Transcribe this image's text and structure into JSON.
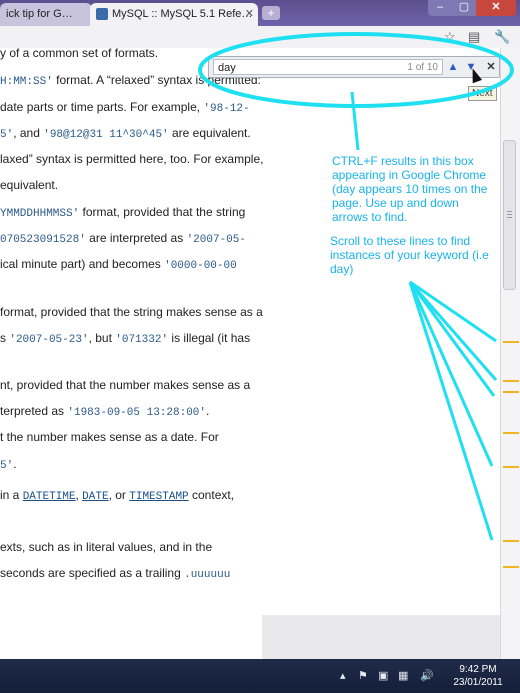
{
  "tabs": [
    {
      "label": "ick tip for G…",
      "active": false
    },
    {
      "label": "MySQL :: MySQL 5.1 Refe…",
      "active": true
    }
  ],
  "window_buttons": {
    "minimize": "–",
    "maximize": "▢",
    "close": "✕"
  },
  "toolbar_icons": [
    "star-icon",
    "page-icon",
    "wrench-icon"
  ],
  "find_bar": {
    "query": "day",
    "count": "1 of 10",
    "prev": "▲",
    "next": "▼",
    "close": "✕",
    "tooltip": "Next"
  },
  "content_lines": [
    {
      "t": [
        {
          "s": "y of a common set of formats."
        }
      ]
    },
    {
      "t": [
        {
          "s": "H:MM:SS'",
          "c": 1
        },
        {
          "s": " format. A “relaxed” syntax is permitted:"
        }
      ]
    },
    {
      "t": [
        {
          "s": " date parts or time parts. For example, "
        },
        {
          "s": "'98-12-",
          "c": 1
        }
      ]
    },
    {
      "t": [
        {
          "s": "5'",
          "c": 1
        },
        {
          "s": ", and "
        },
        {
          "s": "'98@12@31 11^30^45'",
          "c": 1
        },
        {
          "s": " are equivalent."
        }
      ]
    },
    {
      "t": [
        {
          "s": "laxed” syntax is permitted here, too. For example,"
        }
      ]
    },
    {
      "t": [
        {
          "s": "equivalent."
        }
      ]
    },
    {
      "t": [
        {
          "s": "YMMDDHHMMSS'",
          "c": 1
        },
        {
          "s": " format, provided that the string"
        }
      ]
    },
    {
      "t": [
        {
          "s": "070523091528'",
          "c": 1
        },
        {
          "s": " are interpreted as "
        },
        {
          "s": "'2007-05-",
          "c": 1
        }
      ]
    },
    {
      "t": [
        {
          "s": "ical minute part) and becomes "
        },
        {
          "s": "'0000-00-00",
          "c": 1
        }
      ]
    },
    {
      "t": [
        {
          "s": " format, provided that the string makes sense as a"
        }
      ]
    },
    {
      "t": [
        {
          "s": "s "
        },
        {
          "s": "'2007-05-23'",
          "c": 1
        },
        {
          "s": ", but "
        },
        {
          "s": "'071332'",
          "c": 1
        },
        {
          "s": " is illegal (it has"
        }
      ]
    },
    {
      "t": [
        {
          "s": "nt, provided that the number makes sense as a"
        }
      ]
    },
    {
      "t": [
        {
          "s": "terpreted as "
        },
        {
          "s": "'1983-09-05 13:28:00'",
          "c": 1
        },
        {
          "s": "."
        }
      ]
    },
    {
      "t": [
        {
          "s": "t the number makes sense as a date. For"
        }
      ]
    },
    {
      "t": [
        {
          "s": "5'",
          "c": 1
        },
        {
          "s": "."
        }
      ]
    },
    {
      "t": [
        {
          "s": " in a "
        },
        {
          "s": "DATETIME",
          "c": 2
        },
        {
          "s": ", "
        },
        {
          "s": "DATE",
          "c": 2
        },
        {
          "s": ", or "
        },
        {
          "s": "TIMESTAMP",
          "c": 2
        },
        {
          "s": " context,"
        }
      ]
    },
    {
      "t": [
        {
          "s": "exts, such as in literal values, and in the"
        }
      ]
    },
    {
      "t": [
        {
          "s": "seconds are specified as a trailing "
        },
        {
          "s": ".uuuuuu",
          "c": 1
        }
      ]
    }
  ],
  "annotations": {
    "ctrl_f": "CTRL+F results in this box appearing in Google Chrome (day appears 10 times on the page. Use up and down arrows to find.",
    "scroll": "Scroll to these lines to find instances of your keyword (i.e day)"
  },
  "colors": {
    "annotation": "#19b3e8",
    "scroll_mark": "#f0b323",
    "code": "#2c5a8a"
  },
  "taskbar": {
    "time": "9:42 PM",
    "date": "23/01/2011",
    "tray_icons": [
      "chevron-up-icon",
      "flag-icon",
      "device-icon",
      "network-icon",
      "volume-icon"
    ]
  }
}
